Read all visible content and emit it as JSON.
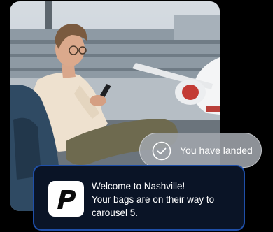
{
  "photo": {
    "subject": "traveler-at-airport"
  },
  "toast": {
    "text": "You have landed",
    "icon": "check-circle-icon"
  },
  "notification": {
    "line1": "Welcome to Nashville!",
    "line2": "Your bags are on their way to",
    "line3": "carousel 5.",
    "logo_icon": "p-logo-icon"
  },
  "colors": {
    "background": "#000000",
    "card_background": "#0a1426",
    "card_border": "#1f4fa8",
    "toast_background": "#a0a5ac"
  }
}
